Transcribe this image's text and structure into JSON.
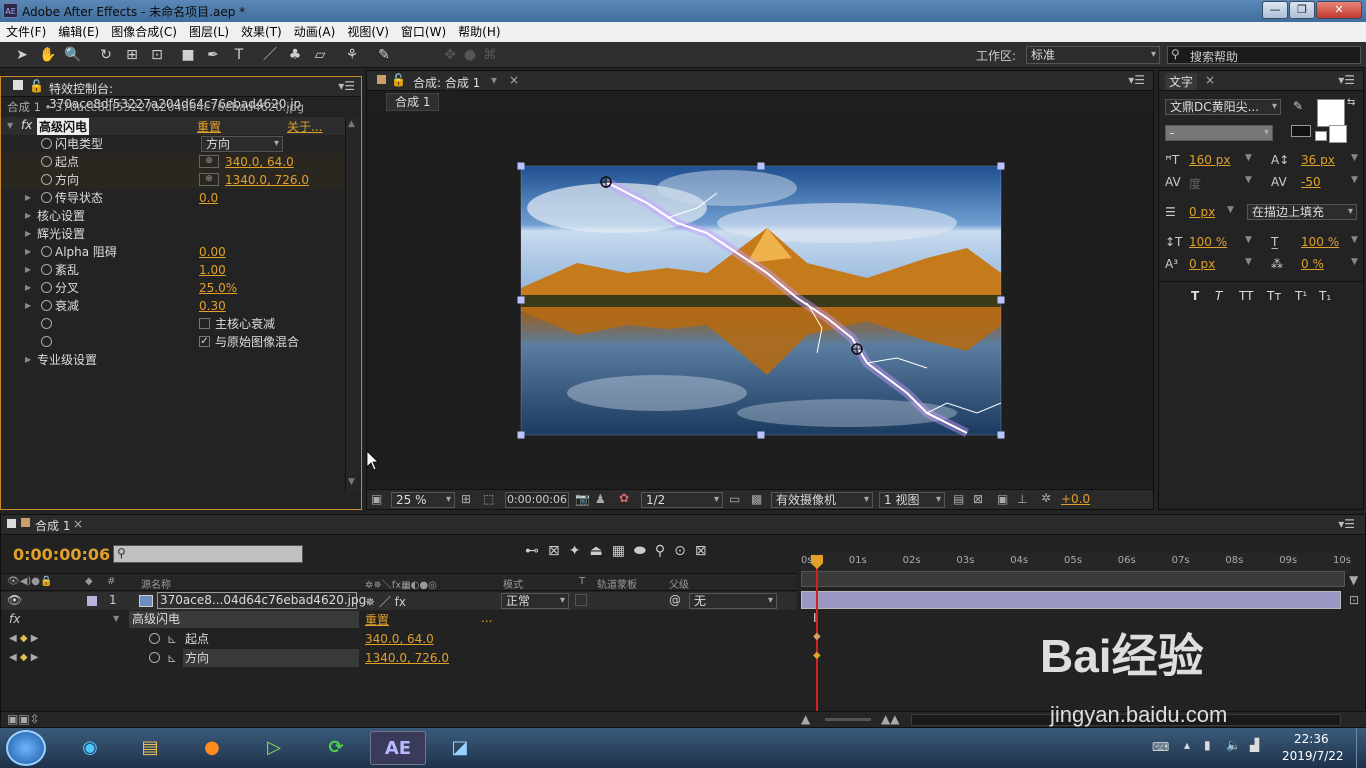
{
  "titlebar": {
    "title": "Adobe After Effects - 未命名项目.aep *",
    "app_icon": "AE",
    "min": "—",
    "max": "❐",
    "close": "✕"
  },
  "menu": [
    "文件(F)",
    "编辑(E)",
    "图像合成(C)",
    "图层(L)",
    "效果(T)",
    "动画(A)",
    "视图(V)",
    "窗口(W)",
    "帮助(H)"
  ],
  "toolbar": {
    "workspace_label": "工作区:",
    "workspace_value": "标准",
    "search_help": "搜索帮助"
  },
  "effects_panel": {
    "tab": "特效控制台: 370ace8df53227a204d64c76ebad4620.jp",
    "subtitle": "合成 1 • 370ace8df53227a204d64c76ebad4620.jpg",
    "effect_name": "高级闪电",
    "reset": "重置",
    "about": "关于...",
    "rows": [
      {
        "label": "闪电类型",
        "value": "方向",
        "kind": "dropdown"
      },
      {
        "label": "起点",
        "value": "340.0, 64.0",
        "kind": "point"
      },
      {
        "label": "方向",
        "value": "1340.0, 726.0",
        "kind": "point"
      },
      {
        "label": "传导状态",
        "value": "0.0",
        "kind": "num"
      },
      {
        "label": "核心设置",
        "value": "",
        "kind": "group"
      },
      {
        "label": "辉光设置",
        "value": "",
        "kind": "group"
      },
      {
        "label": "Alpha 阻碍",
        "value": "0.00",
        "kind": "num"
      },
      {
        "label": "紊乱",
        "value": "1.00",
        "kind": "num"
      },
      {
        "label": "分叉",
        "value": "25.0%",
        "kind": "num"
      },
      {
        "label": "衰减",
        "value": "0.30",
        "kind": "num"
      },
      {
        "label": "主核心衰减",
        "value": "",
        "kind": "check",
        "checked": false
      },
      {
        "label": "与原始图像混合",
        "value": "",
        "kind": "check",
        "checked": true
      },
      {
        "label": "专业级设置",
        "value": "",
        "kind": "group"
      }
    ]
  },
  "comp_panel": {
    "tab": "合成: 合成 1",
    "breadcrumb": "合成 1",
    "zoom": "25 %",
    "timecode": "0:00:00:06",
    "resolution": "1/2",
    "camera": "有效摄像机",
    "views": "1 视图",
    "exposure": "+0.0"
  },
  "char_panel": {
    "tab": "文字",
    "font": "文鼎DC黄阳尖...",
    "style": "-",
    "size": "160 px",
    "leading": "36 px",
    "kerning_label": "度",
    "tracking": "-50",
    "stroke": "0 px",
    "stroke_mode": "在描边上填充",
    "vscale": "100 %",
    "hscale": "100 %",
    "baseline": "0 px",
    "tsume": "0 %",
    "styles": [
      "T",
      "T",
      "TT",
      "Tт",
      "T¹",
      "T₁"
    ]
  },
  "timeline": {
    "tab": "合成 1",
    "timecode": "0:00:00:06",
    "headers": {
      "source": "源名称",
      "mode": "模式",
      "t": "T",
      "trkmat": "轨道蒙板",
      "parent": "父级"
    },
    "layer": {
      "num": "1",
      "name": "370ace8...04d64c76ebad4620.jpg",
      "mode": "正常",
      "parent": "无"
    },
    "effect_row": {
      "name": "高级闪电",
      "reset": "重置"
    },
    "props": [
      {
        "name": "起点",
        "value": "340.0, 64.0"
      },
      {
        "name": "方向",
        "value": "1340.0, 726.0"
      }
    ],
    "ruler": [
      "0s",
      "01s",
      "02s",
      "03s",
      "04s",
      "05s",
      "06s",
      "07s",
      "08s",
      "09s",
      "10s"
    ]
  },
  "watermark": {
    "brand": "Bai经验",
    "url": "jingyan.baidu.com"
  },
  "taskbar": {
    "time": "22:36",
    "date": "2019/7/22"
  }
}
